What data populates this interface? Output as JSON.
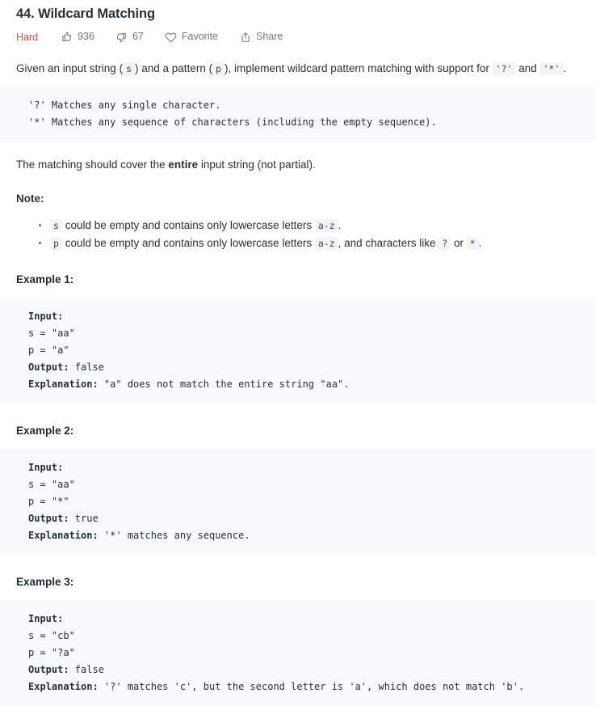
{
  "problem": {
    "title": "44. Wildcard Matching",
    "difficulty": "Hard"
  },
  "actions": {
    "likes": "936",
    "dislikes": "67",
    "favorite_label": "Favorite",
    "share_label": "Share",
    "icons": {
      "like": "thumbs-up-icon",
      "dislike": "thumbs-down-icon",
      "favorite": "heart-icon",
      "share": "share-icon"
    }
  },
  "description": {
    "intro_part1": "Given an input string (",
    "intro_code_s": "s",
    "intro_part2": ") and a pattern (",
    "intro_code_p": "p",
    "intro_part3": "), implement wildcard pattern matching with support for ",
    "intro_code_q": "'?'",
    "intro_part4": " and ",
    "intro_code_star": "'*'",
    "intro_part5": ".",
    "rules_block": "'?' Matches any single character.\n'*' Matches any sequence of characters (including the empty sequence).",
    "coverage_part1": "The matching should cover the ",
    "coverage_bold": "entire",
    "coverage_part2": " input string (not partial).",
    "note_heading": "Note:",
    "notes": [
      {
        "code_var": "s",
        "text_part1": " could be empty and contains only lowercase letters ",
        "code_range": "a-z",
        "text_part2": "."
      },
      {
        "code_var": "p",
        "text_part1": " could be empty and contains only lowercase letters ",
        "code_range": "a-z",
        "text_part2": ", and characters like ",
        "code_q": "?",
        "text_part3": " or ",
        "code_star": "*",
        "text_part4": "."
      }
    ]
  },
  "examples": [
    {
      "heading": "Example 1:",
      "input_label": "Input:",
      "s_line": "s = \"aa\"",
      "p_line": "p = \"a\"",
      "output_label": "Output:",
      "output_value": " false",
      "explanation_label": "Explanation:",
      "explanation_value": " \"a\" does not match the entire string \"aa\"."
    },
    {
      "heading": "Example 2:",
      "input_label": "Input:",
      "s_line": "s = \"aa\"",
      "p_line": "p = \"*\"",
      "output_label": "Output:",
      "output_value": " true",
      "explanation_label": "Explanation:",
      "explanation_value": " '*' matches any sequence."
    },
    {
      "heading": "Example 3:",
      "input_label": "Input:",
      "s_line": "s = \"cb\"",
      "p_line": "p = \"?a\"",
      "output_label": "Output:",
      "output_value": " false",
      "explanation_label": "Explanation:",
      "explanation_value": " '?' matches 'c', but the second letter is 'a', which does not match 'b'."
    }
  ],
  "colors": {
    "difficulty_hard": "#ef4743",
    "code_block_bg": "#f7f9fa",
    "inline_code_bg": "#f2f4f5",
    "text": "#263238"
  }
}
